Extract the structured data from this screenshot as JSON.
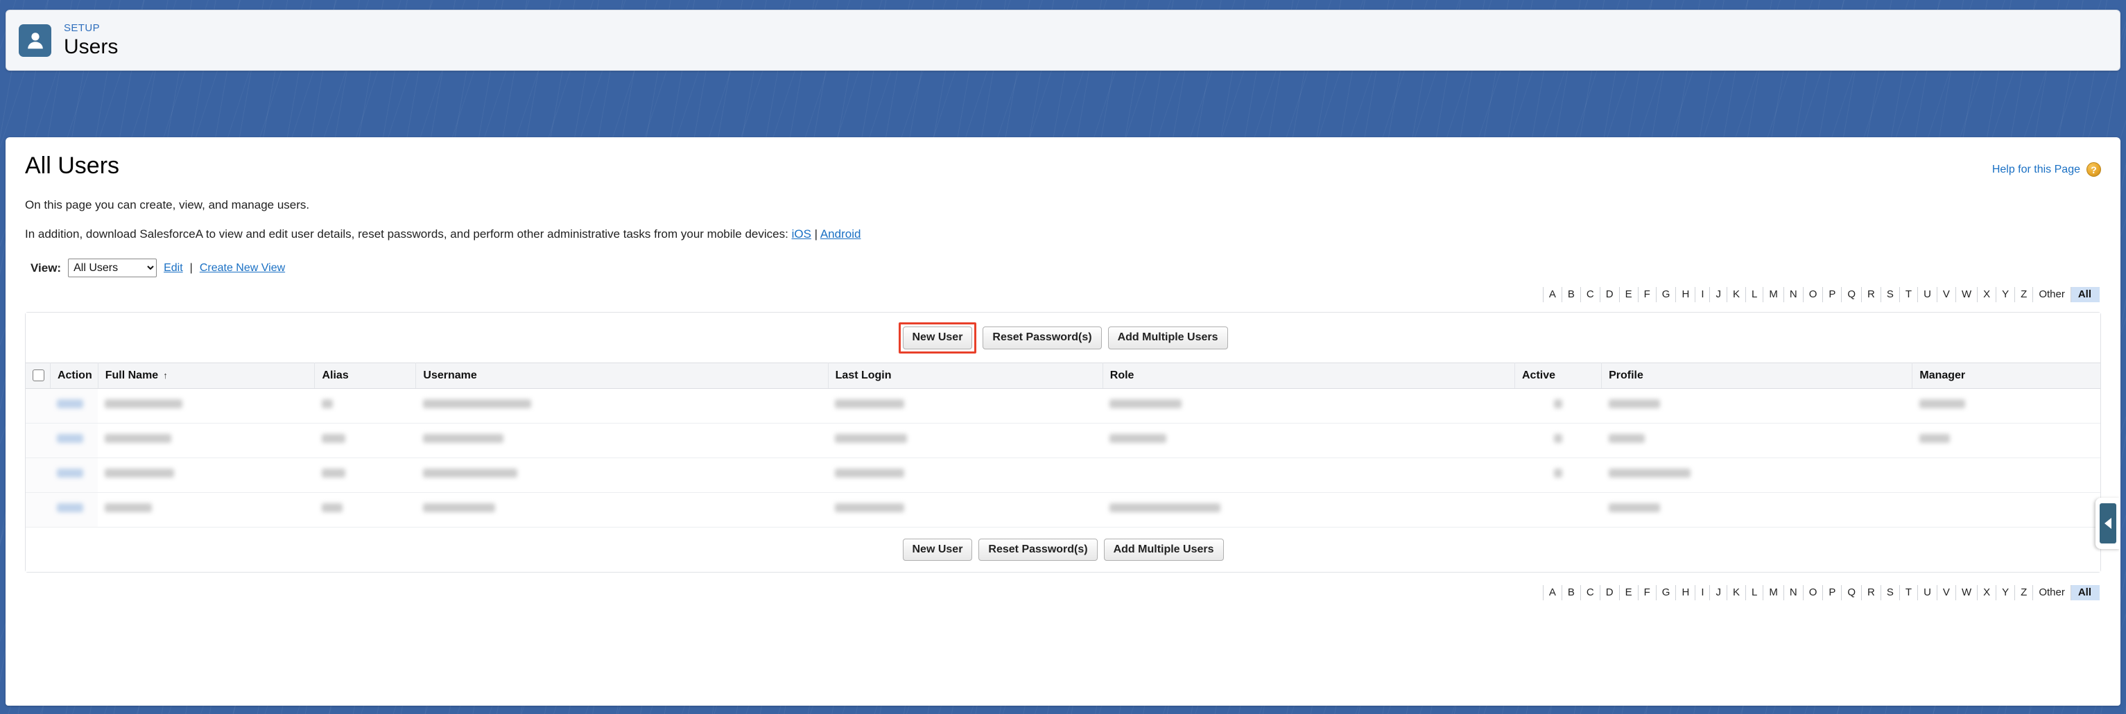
{
  "setup_header": {
    "eyebrow": "SETUP",
    "title": "Users",
    "icon": "user-avatar-icon"
  },
  "page": {
    "title": "All Users",
    "help_link": "Help for this Page",
    "help_icon": "question-mark-icon",
    "intro_line1": "On this page you can create, view, and manage users.",
    "intro_line2_prefix": "In addition, download SalesforceA to view and edit user details, reset passwords, and perform other administrative tasks from your mobile devices: ",
    "intro_link_ios": "iOS",
    "intro_link_separator": " | ",
    "intro_link_android": "Android"
  },
  "view": {
    "label": "View:",
    "selected": "All Users",
    "options": [
      "All Users"
    ],
    "edit_label": "Edit",
    "separator": "|",
    "create_label": "Create New View"
  },
  "alpha_filter": {
    "letters": [
      "A",
      "B",
      "C",
      "D",
      "E",
      "F",
      "G",
      "H",
      "I",
      "J",
      "K",
      "L",
      "M",
      "N",
      "O",
      "P",
      "Q",
      "R",
      "S",
      "T",
      "U",
      "V",
      "W",
      "X",
      "Y",
      "Z"
    ],
    "other_label": "Other",
    "all_label": "All",
    "selected": "All"
  },
  "toolbar": {
    "new_user": "New User",
    "reset_passwords": "Reset Password(s)",
    "add_multiple_users": "Add Multiple Users",
    "highlight_color": "#e8402a",
    "highlighted_button": "New User"
  },
  "table": {
    "columns": [
      {
        "key": "check",
        "label": ""
      },
      {
        "key": "action",
        "label": "Action"
      },
      {
        "key": "name",
        "label": "Full Name",
        "sorted": true,
        "sort_dir": "asc",
        "sort_glyph": "↑"
      },
      {
        "key": "alias",
        "label": "Alias"
      },
      {
        "key": "username",
        "label": "Username"
      },
      {
        "key": "login",
        "label": "Last Login"
      },
      {
        "key": "role",
        "label": "Role"
      },
      {
        "key": "active",
        "label": "Active"
      },
      {
        "key": "profile",
        "label": "Profile"
      },
      {
        "key": "manager",
        "label": "Manager"
      }
    ],
    "rows_redacted": true,
    "row_count": 4,
    "rows": [
      {
        "action_w": 38,
        "name_w": 112,
        "alias_w": 16,
        "username_w": 156,
        "login_w": 100,
        "role_w": 104,
        "active": true,
        "profile_w": 74,
        "manager_w": 66
      },
      {
        "action_w": 38,
        "name_w": 96,
        "alias_w": 34,
        "username_w": 116,
        "login_w": 104,
        "role_w": 82,
        "active": true,
        "profile_w": 52,
        "manager_w": 44
      },
      {
        "action_w": 38,
        "name_w": 100,
        "alias_w": 34,
        "username_w": 136,
        "login_w": 100,
        "role_w": 0,
        "active": true,
        "profile_w": 118,
        "manager_w": 0
      },
      {
        "action_w": 38,
        "name_w": 68,
        "alias_w": 30,
        "username_w": 104,
        "login_w": 100,
        "role_w": 160,
        "active": false,
        "profile_w": 74,
        "manager_w": 0
      }
    ]
  },
  "side_panel_tab": {
    "icon": "chevron-left-icon",
    "color": "#35647f"
  }
}
